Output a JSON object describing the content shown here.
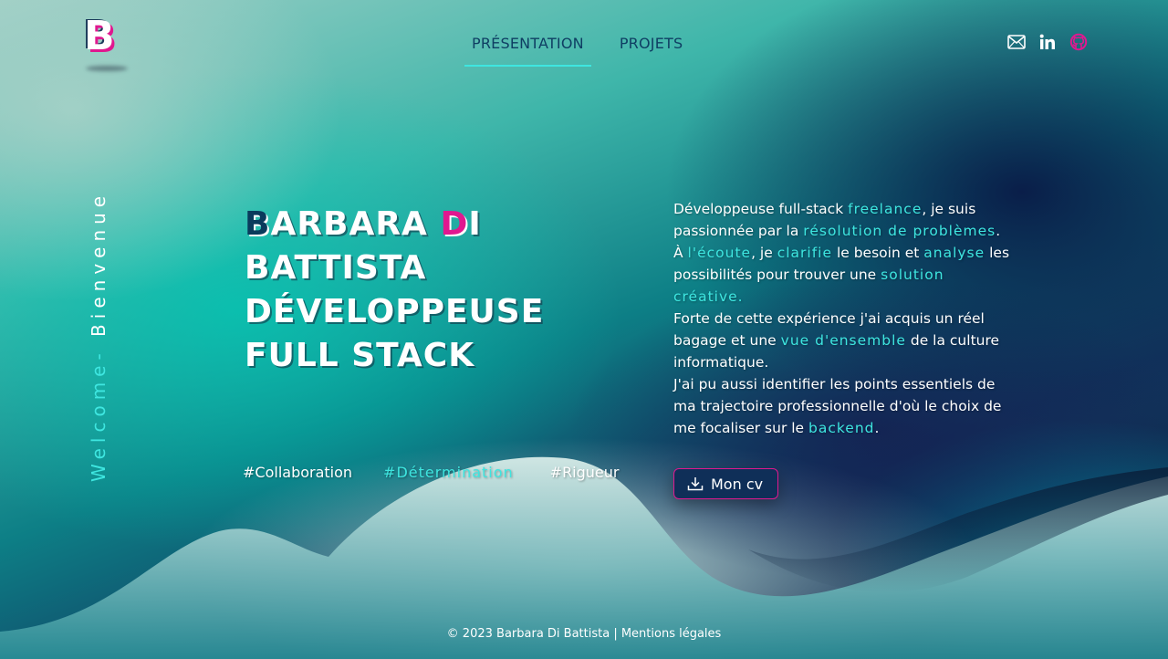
{
  "logo": {
    "letters": "B",
    "alt_text": ""
  },
  "nav": {
    "items": [
      {
        "label": "PRÉSENTATION",
        "active": true
      },
      {
        "label": "PROJETS",
        "active": false
      }
    ]
  },
  "social": {
    "icons": [
      "mail-icon",
      "linkedin-icon",
      "github-icon"
    ]
  },
  "side_text": {
    "welcome": "Welcome-",
    "bienvenue": "Bienvenue"
  },
  "hero": {
    "initial_b": "B",
    "rest_b": "ARBARA ",
    "initial_d": "D",
    "rest_d": "I",
    "line2": "BATTISTA",
    "line3": "DÉVELOPPEUSE",
    "line4": "FULL STACK"
  },
  "tags": [
    "#Collaboration",
    "#Détermination",
    "#Rigueur"
  ],
  "intro": {
    "p1_a": "Développeuse full-stack ",
    "p1_k1": "freelance",
    "p1_b": ", je suis passionnée par la ",
    "p1_k2": "résolution de problèmes",
    "p1_c": ".",
    "p2_a": "À ",
    "p2_k1": "l'écoute",
    "p2_b": ", je ",
    "p2_k2": "clarifie",
    "p2_c": " le besoin et ",
    "p2_k3": "analyse",
    "p2_d": " les possibilités pour trouver une ",
    "p2_k4": "solution créative.",
    "p3_a": "Forte de cette expérience j'ai acquis un réel bagage et une ",
    "p3_k1": "vue d'ensemble",
    "p3_b": " de la culture informatique.",
    "p4_a": "J'ai pu aussi identifier les points essentiels de ma trajectoire professionnelle d'où le choix de me focaliser sur le ",
    "p4_k1": "backend",
    "p4_b": "."
  },
  "cv_button": {
    "label": "Mon cv"
  },
  "footer": {
    "copyright": "© 2023 Barbara Di Battista | ",
    "legal": "Mentions légales"
  },
  "colors": {
    "accent_cyan": "#3ee6e0",
    "accent_pink": "#e0188f",
    "nav_text": "#0f3e63"
  }
}
